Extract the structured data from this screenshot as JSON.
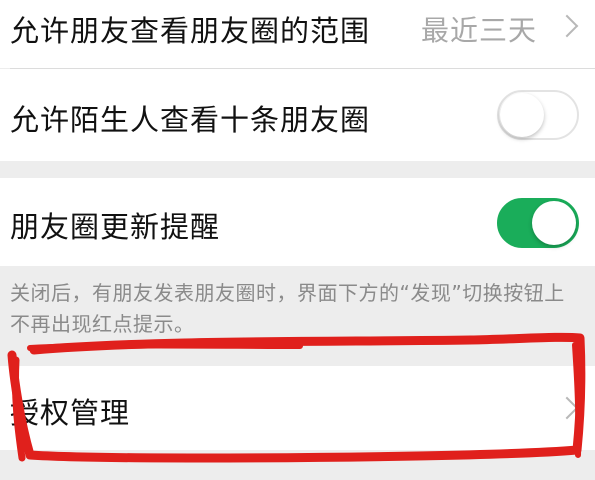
{
  "settings": {
    "friends_range": {
      "label": "允许朋友查看朋友圈的范围",
      "value": "最近三天"
    },
    "stranger_ten_posts": {
      "label": "允许陌生人查看十条朋友圈",
      "enabled": false
    },
    "moments_update_reminder": {
      "label": "朋友圈更新提醒",
      "enabled": true
    },
    "reminder_hint": "关闭后，有朋友发表朋友圈时，界面下方的“发现”切换按钮上不再出现红点提示。",
    "authorization": {
      "label": "授权管理"
    }
  },
  "colors": {
    "toggle_on": "#1aad5a",
    "annotation_stroke": "#e0201c"
  }
}
